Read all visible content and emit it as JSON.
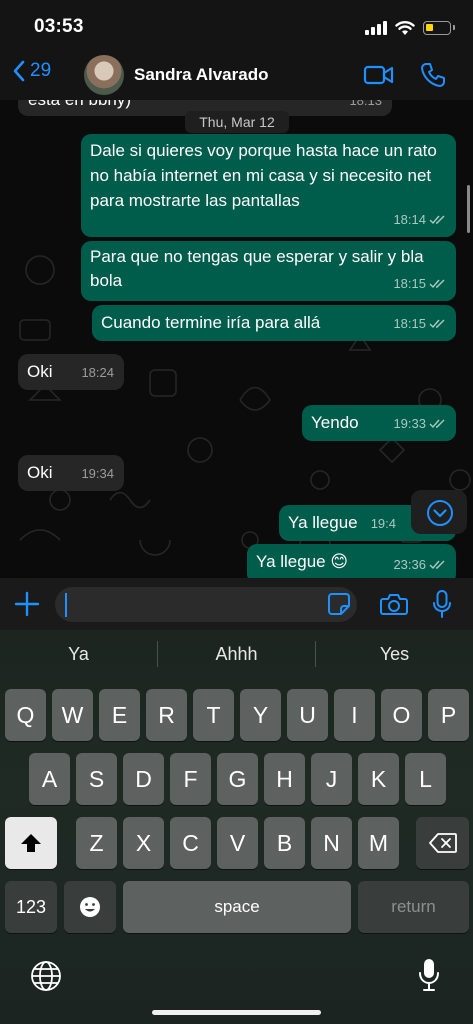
{
  "status_bar": {
    "time": "03:53"
  },
  "header": {
    "back_count": "29",
    "contact_name": "Sandra Alvarado"
  },
  "chat": {
    "date_divider": "Thu, Mar 12",
    "messages": [
      {
        "direction": "in",
        "text": "esta en bbny)",
        "time": "18:13"
      },
      {
        "direction": "out",
        "text": "Dale si quieres voy porque hasta hace un rato no había internet en mi casa y si necesito net para mostrarte las pantallas",
        "time": "18:14"
      },
      {
        "direction": "out",
        "text": "Para que no tengas que esperar y salir y bla bola",
        "time": "18:15"
      },
      {
        "direction": "out",
        "text": "Cuando termine iría para allá",
        "time": "18:15"
      },
      {
        "direction": "in",
        "text": "Oki",
        "time": "18:24"
      },
      {
        "direction": "out",
        "text": "Yendo",
        "time": "19:33"
      },
      {
        "direction": "in",
        "text": "Oki",
        "time": "19:34"
      },
      {
        "direction": "out",
        "text": "Ya llegue",
        "time": "19:4"
      },
      {
        "direction": "out",
        "text": "Ya llegue 😊",
        "time": "23:36"
      }
    ]
  },
  "input": {
    "value": "",
    "placeholder": ""
  },
  "keyboard": {
    "suggestions": [
      "Ya",
      "Ahhh",
      "Yes"
    ],
    "row1": [
      "Q",
      "W",
      "E",
      "R",
      "T",
      "Y",
      "U",
      "I",
      "O",
      "P"
    ],
    "row2": [
      "A",
      "S",
      "D",
      "F",
      "G",
      "H",
      "J",
      "K",
      "L"
    ],
    "row3": [
      "Z",
      "X",
      "C",
      "V",
      "B",
      "N",
      "M"
    ],
    "numbers_label": "123",
    "space_label": "space",
    "return_label": "return"
  },
  "colors": {
    "accent": "#1e90ff",
    "outgoing_bubble": "#005c4b",
    "incoming_bubble": "#262626",
    "battery": "#ffd60a"
  },
  "icons": [
    "signal-icon",
    "wifi-icon",
    "battery-icon",
    "chevron-left-icon",
    "video-camera-icon",
    "phone-icon",
    "chevron-down-icon",
    "plus-icon",
    "sticker-icon",
    "camera-icon",
    "microphone-icon",
    "shift-icon",
    "backspace-icon",
    "emoji-icon",
    "globe-icon"
  ]
}
